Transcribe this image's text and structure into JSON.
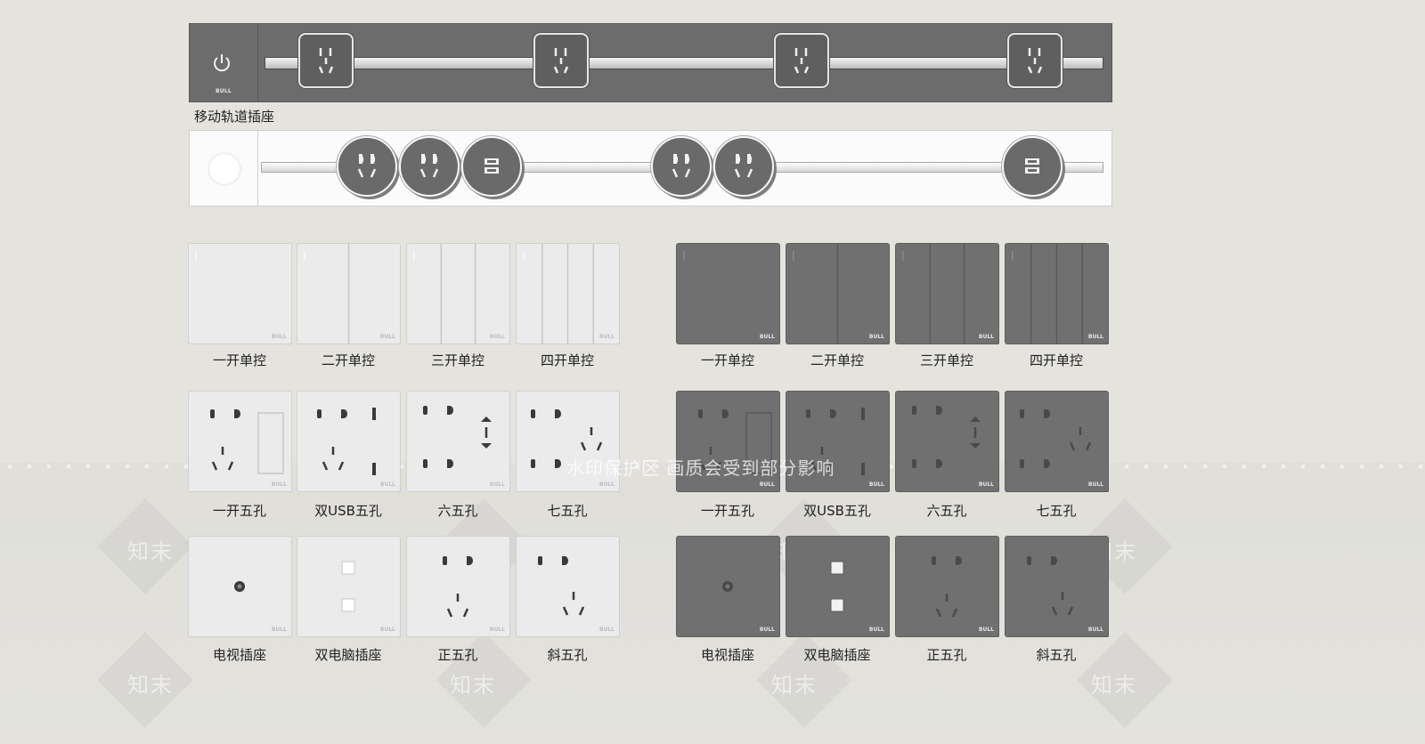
{
  "track_title": "移动轨道插座",
  "brand": "BULL",
  "colors": {
    "grey": "#707070",
    "white": "#ebebeb",
    "background": "#e4e3de"
  },
  "track_dark": {
    "endcap_icon": "power-icon",
    "adapters": [
      "five-hole-adapter",
      "five-hole-adapter",
      "five-hole-adapter",
      "five-hole-adapter"
    ]
  },
  "track_light": {
    "endcap_icon": "knob",
    "adapters": [
      "two-three-adapter",
      "two-three-adapter",
      "usb-adapter",
      "two-three-adapter",
      "two-three-adapter",
      "usb-adapter"
    ]
  },
  "white_switches": [
    "一开单控",
    "二开单控",
    "三开单控",
    "四开单控"
  ],
  "white_sockets": [
    "一开五孔",
    "双USB五孔",
    "六五孔",
    "七五孔"
  ],
  "white_misc": [
    "电视插座",
    "双电脑插座",
    "正五孔",
    "斜五孔"
  ],
  "grey_switches": [
    "一开单控",
    "二开单控",
    "三开单控",
    "四开单控"
  ],
  "grey_sockets": [
    "一开五孔",
    "双USB五孔",
    "六五孔",
    "七五孔"
  ],
  "grey_misc": [
    "电视插座",
    "双电脑插座",
    "正五孔",
    "斜五孔"
  ],
  "watermark": {
    "notice": "水印保护区 画质会受到部分影响",
    "logo_text": "知末"
  }
}
